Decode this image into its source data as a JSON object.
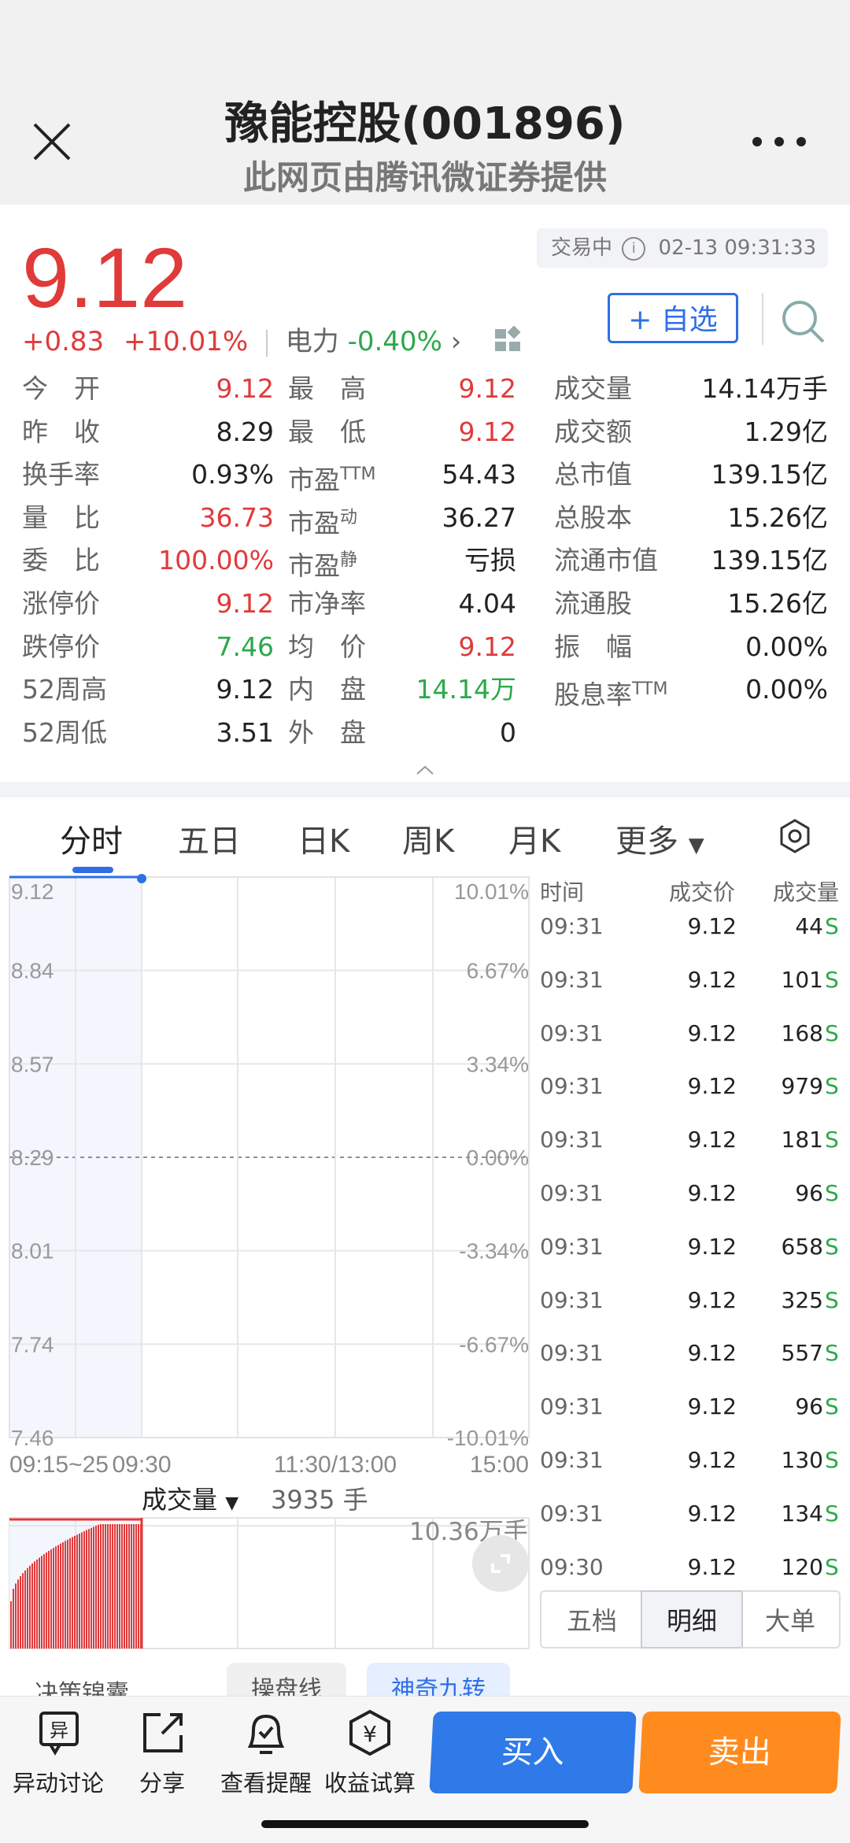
{
  "header": {
    "title": "豫能控股(001896)",
    "subtitle": "此网页由腾讯微证券提供"
  },
  "quote": {
    "price": "9.12",
    "status": "交易中",
    "datetime": "02-13 09:31:33",
    "change": "+0.83",
    "change_pct": "+10.01%",
    "sector_name": "电力",
    "sector_pct": "-0.40%",
    "watch_label": "+ 自选"
  },
  "stats": {
    "col1": [
      {
        "label": "今　开",
        "value": "9.12",
        "color": "red"
      },
      {
        "label": "昨　收",
        "value": "8.29",
        "color": "black"
      },
      {
        "label": "换手率",
        "value": "0.93%",
        "color": "black"
      },
      {
        "label": "量　比",
        "value": "36.73",
        "color": "red"
      },
      {
        "label": "委　比",
        "value": "100.00%",
        "color": "red"
      },
      {
        "label": "涨停价",
        "value": "9.12",
        "color": "red"
      },
      {
        "label": "跌停价",
        "value": "7.46",
        "color": "green"
      },
      {
        "label": "52周高",
        "value": "9.12",
        "color": "black"
      },
      {
        "label": "52周低",
        "value": "3.51",
        "color": "black"
      }
    ],
    "col2": [
      {
        "label": "最　高",
        "value": "9.12",
        "color": "red"
      },
      {
        "label": "最　低",
        "value": "9.12",
        "color": "red"
      },
      {
        "label": "市盈",
        "sup": "TTM",
        "value": "54.43",
        "color": "black"
      },
      {
        "label": "市盈",
        "sup": "动",
        "value": "36.27",
        "color": "black"
      },
      {
        "label": "市盈",
        "sup": "静",
        "value": "亏损",
        "color": "black"
      },
      {
        "label": "市净率",
        "value": "4.04",
        "color": "black"
      },
      {
        "label": "均　价",
        "value": "9.12",
        "color": "red"
      },
      {
        "label": "内　盘",
        "value": "14.14万",
        "color": "green"
      },
      {
        "label": "外　盘",
        "value": "0",
        "color": "black"
      }
    ],
    "col3": [
      {
        "label": "成交量",
        "value": "14.14万手",
        "color": "black"
      },
      {
        "label": "成交额",
        "value": "1.29亿",
        "color": "black"
      },
      {
        "label": "总市值",
        "value": "139.15亿",
        "color": "black"
      },
      {
        "label": "总股本",
        "value": "15.26亿",
        "color": "black"
      },
      {
        "label": "流通市值",
        "value": "139.15亿",
        "color": "black"
      },
      {
        "label": "流通股",
        "value": "15.26亿",
        "color": "black"
      },
      {
        "label": "振　幅",
        "value": "0.00%",
        "color": "black"
      },
      {
        "label": "股息率",
        "sup": "TTM",
        "value": "0.00%",
        "color": "black"
      }
    ]
  },
  "tabs": [
    "分时",
    "五日",
    "日K",
    "周K",
    "月K",
    "更多"
  ],
  "chart_data": {
    "type": "line",
    "y_left_ticks": [
      "9.12",
      "8.84",
      "8.57",
      "8.29",
      "8.01",
      "7.74",
      "7.46"
    ],
    "y_right_ticks": [
      "10.01%",
      "6.67%",
      "3.34%",
      "0.00%",
      "-3.34%",
      "-6.67%",
      "-10.01%"
    ],
    "x_ticks": [
      "09:15~25",
      "09:30",
      "11:30/13:00",
      "15:00"
    ],
    "ylim": [
      7.46,
      9.12
    ],
    "prev_close": 8.29,
    "series": [
      {
        "values": [
          9.12,
          9.12
        ]
      }
    ],
    "volume_label": "成交量",
    "volume_value": "3935 手",
    "volume_max": "10.36万手"
  },
  "trades": {
    "headers": [
      "时间",
      "成交价",
      "成交量"
    ],
    "rows": [
      {
        "time": "09:31",
        "price": "9.12",
        "vol": "44",
        "side": "S"
      },
      {
        "time": "09:31",
        "price": "9.12",
        "vol": "101",
        "side": "S"
      },
      {
        "time": "09:31",
        "price": "9.12",
        "vol": "168",
        "side": "S"
      },
      {
        "time": "09:31",
        "price": "9.12",
        "vol": "979",
        "side": "S"
      },
      {
        "time": "09:31",
        "price": "9.12",
        "vol": "181",
        "side": "S"
      },
      {
        "time": "09:31",
        "price": "9.12",
        "vol": "96",
        "side": "S"
      },
      {
        "time": "09:31",
        "price": "9.12",
        "vol": "658",
        "side": "S"
      },
      {
        "time": "09:31",
        "price": "9.12",
        "vol": "325",
        "side": "S"
      },
      {
        "time": "09:31",
        "price": "9.12",
        "vol": "557",
        "side": "S"
      },
      {
        "time": "09:31",
        "price": "9.12",
        "vol": "96",
        "side": "S"
      },
      {
        "time": "09:31",
        "price": "9.12",
        "vol": "130",
        "side": "S"
      },
      {
        "time": "09:31",
        "price": "9.12",
        "vol": "134",
        "side": "S"
      },
      {
        "time": "09:30",
        "price": "9.12",
        "vol": "120",
        "side": "S"
      }
    ],
    "subtabs": [
      "五档",
      "明细",
      "大单"
    ]
  },
  "partial_row": [
    "决策锦囊",
    "操盘线",
    "神奇九转"
  ],
  "toolbar": {
    "items": [
      "异动讨论",
      "分享",
      "查看提醒",
      "收益试算"
    ],
    "buy": "买入",
    "sell": "卖出"
  },
  "colors": {
    "red": "#e03a3a",
    "green": "#2da84a",
    "blue": "#2f6fe6",
    "orange": "#ff8b1f"
  }
}
